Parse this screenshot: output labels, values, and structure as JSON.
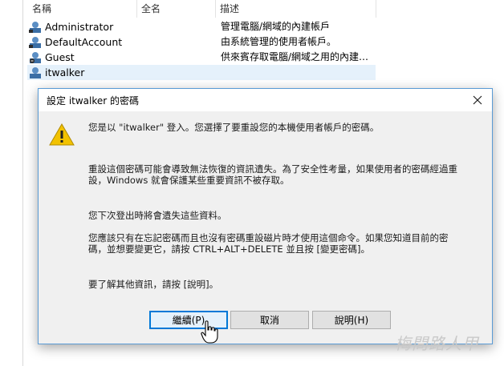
{
  "listview": {
    "columns": [
      "名稱",
      "全名",
      "描述"
    ],
    "rows": [
      {
        "name": "Administrator",
        "fullname": "",
        "description": "管理電腦/網域的內建帳戶"
      },
      {
        "name": "DefaultAccount",
        "fullname": "",
        "description": "由系統管理的使用者帳戶。"
      },
      {
        "name": "Guest",
        "fullname": "",
        "description": "供來賓存取電腦/網域之用的內建…"
      },
      {
        "name": "itwalker",
        "fullname": "",
        "description": ""
      }
    ]
  },
  "dialog": {
    "title": "設定 itwalker 的密碼",
    "messages": [
      "您是以 \"itwalker\" 登入。您選擇了要重設您的本機使用者帳戶的密碼。",
      "重設這個密碼可能會導致無法恢復的資訊遺失。為了安全性考量，如果使用者的密碼經過重",
      "設，Windows 就會保護某些重要資訊不被存取。",
      "您下次登出時將會遺失這些資料。",
      "您應該只有在忘記密碼而且也沒有密碼重設磁片時才使用這個命令。如果您知道目前的密",
      "碼，並想要變更它，請按 CTRL+ALT+DELETE 並且按 [變更密碼]。",
      "要了解其他資訊，請按 [說明]。"
    ],
    "buttons": {
      "continue": "繼續(P)",
      "cancel": "取消",
      "help": "說明(H)"
    }
  },
  "watermark": "梅問路人甲",
  "colors": {
    "accent": "#0078d7",
    "warning": "#f2c200"
  }
}
